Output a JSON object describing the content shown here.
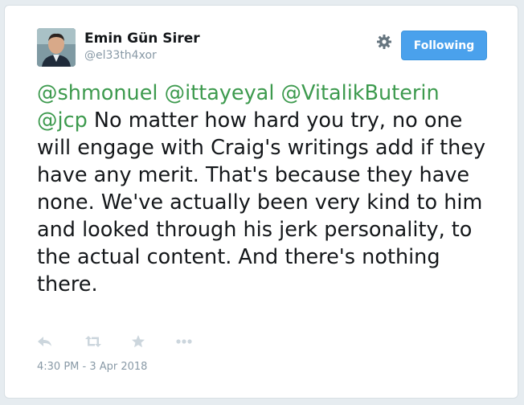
{
  "author": {
    "name": "Emin Gün Sirer",
    "handle": "@el33th4xor"
  },
  "follow_button": {
    "label": "Following",
    "color": "#4aa1ec"
  },
  "settings": {
    "icon": "gear-icon"
  },
  "tweet": {
    "mentions": [
      "@shmonuel",
      "@ittayeyal",
      "@VitalikButerin",
      "@jcp"
    ],
    "text": "No matter how hard you try, no one will engage with Craig's writings add if they have any merit. That's because they have none. We've actually been very kind to him and looked through his jerk personality, to the actual content. And there's nothing there.",
    "mention_color": "#3d9a4e"
  },
  "actions": [
    {
      "icon": "reply-icon"
    },
    {
      "icon": "retweet-icon"
    },
    {
      "icon": "favorite-star-icon"
    },
    {
      "icon": "more-options-icon"
    }
  ],
  "timestamp": "4:30 PM - 3 Apr 2018"
}
